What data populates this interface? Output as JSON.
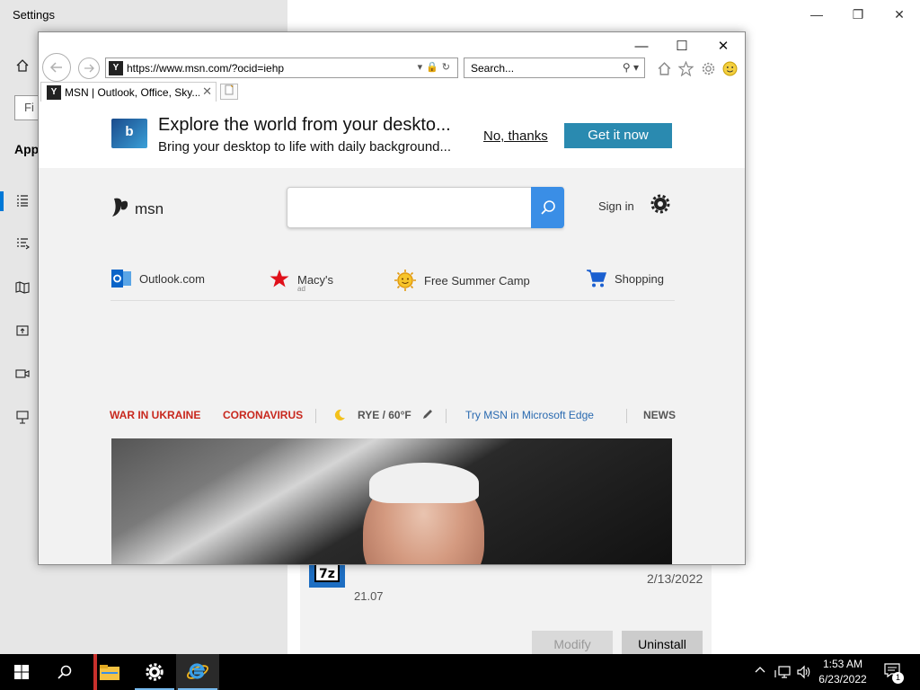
{
  "settings": {
    "title": "Settings",
    "find_placeholder": "Fi",
    "apps_heading": "App",
    "app_entry": {
      "icon_text": "7z",
      "date": "2/13/2022",
      "version": "21.07",
      "modify_label": "Modify",
      "uninstall_label": "Uninstall"
    },
    "window_controls": {
      "minimize": "—",
      "maximize": "❐",
      "close": "✕"
    }
  },
  "browser": {
    "window_controls": {
      "minimize": "—",
      "maximize": "☐",
      "close": "✕"
    },
    "address": "https://www.msn.com/?ocid=iehp",
    "address_tools": "▾🔒↻",
    "search_placeholder": "Search...",
    "search_tools": "⚲ ▾",
    "tab_title": "MSN | Outlook, Office, Sky...",
    "tab_close": "✕",
    "favicon_text": "Y",
    "toolbar_icons": [
      "home-icon",
      "favorites-star-icon",
      "tools-gear-icon",
      "feedback-smiley-icon"
    ]
  },
  "banner": {
    "logo_text": "b",
    "title": "Explore the world from your deskto...",
    "subtitle": "Bring your desktop to life with daily background...",
    "dismiss_label": "No, thanks",
    "cta_label": "Get it now"
  },
  "msn": {
    "logo_text": "msn",
    "sign_in": "Sign in",
    "quick_links": [
      {
        "label": "Outlook.com",
        "icon": "outlook-icon"
      },
      {
        "label": "Macy's",
        "icon": "macys-star-icon",
        "ad": "ad"
      },
      {
        "label": "Free Summer Camp",
        "icon": "sun-icon"
      },
      {
        "label": "Shopping",
        "icon": "cart-icon"
      }
    ],
    "nav": {
      "war": "WAR IN UKRAINE",
      "coronavirus": "CORONAVIRUS",
      "weather": "RYE / 60°F",
      "edge": "Try MSN in Microsoft Edge",
      "news": "NEWS"
    }
  },
  "taskbar": {
    "clock_time": "1:53 AM",
    "clock_date": "6/23/2022",
    "notification_count": "1"
  },
  "colors": {
    "accent_blue": "#0078d7",
    "msn_search_blue": "#3a8ee6",
    "cta_teal": "#2a8ab0",
    "nav_red": "#c8281e",
    "nav_blue": "#2a6ab0"
  }
}
